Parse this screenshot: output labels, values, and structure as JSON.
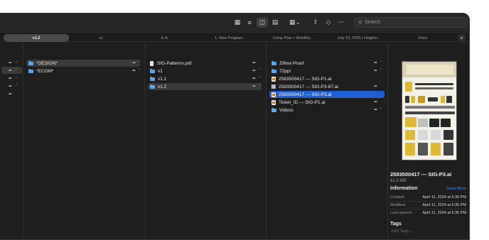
{
  "toolbar": {
    "search_placeholder": "Search",
    "icons": [
      "icon-view-grid-icon",
      "list-view-icon",
      "column-view-icon",
      "gallery-view-icon",
      "group-icon",
      "share-icon",
      "tag-icon",
      "more-icon"
    ]
  },
  "tabs": [
    {
      "label": "v1.2",
      "active": true
    },
    {
      "label": "v1",
      "active": false
    },
    {
      "label": "E.A.",
      "active": false
    },
    {
      "label": "1. New Program",
      "active": false
    },
    {
      "label": "Comp Plan > Monthly...",
      "active": false
    },
    {
      "label": "July 10, 2025 | Heights...",
      "active": false
    },
    {
      "label": "Docs",
      "active": false
    }
  ],
  "column2": {
    "items": [
      {
        "label": "*DESIGN*",
        "type": "folder",
        "selected": true
      },
      {
        "label": "*ECOM*",
        "type": "folder",
        "selected": false
      }
    ]
  },
  "column3": {
    "items": [
      {
        "label": "SIG-Patterns.pdf",
        "type": "file",
        "selected": false
      },
      {
        "label": "v1",
        "type": "folder",
        "selected": false
      },
      {
        "label": "v1.1",
        "type": "folder",
        "selected": false
      },
      {
        "label": "v1.2",
        "type": "folder",
        "selected": true
      }
    ]
  },
  "column4": {
    "items": [
      {
        "label": "Ziflow Proof",
        "type": "folder",
        "selected": false
      },
      {
        "label": "72ppi",
        "type": "folder",
        "selected": false
      },
      {
        "label": "2583500417 — SIG-P1.ai",
        "type": "ai",
        "selected": false
      },
      {
        "label": "2583500417 — SIG-P3-87.ai",
        "type": "grid",
        "selected": false
      },
      {
        "label": "2583500417 — SIG-P3.ai",
        "type": "ai",
        "selected": true
      },
      {
        "label": "Ticket_ID — SIG-P1.ai",
        "type": "ai",
        "selected": false
      },
      {
        "label": "Videos",
        "type": "folder",
        "selected": false
      }
    ]
  },
  "preview": {
    "filename": "2583500417 — SIG-P3.ai",
    "size": "81.9 MB",
    "info_heading": "Information",
    "show_more": "Show More",
    "rows": [
      {
        "label": "Created",
        "value": "April 11, 2024 at 6:36 PM"
      },
      {
        "label": "Modified",
        "value": "April 11, 2024 at 6:36 PM"
      },
      {
        "label": "Last opened",
        "value": "April 11, 2024 at 6:36 PM"
      }
    ],
    "tags_heading": "Tags",
    "tags_placeholder": "Add Tags..."
  }
}
